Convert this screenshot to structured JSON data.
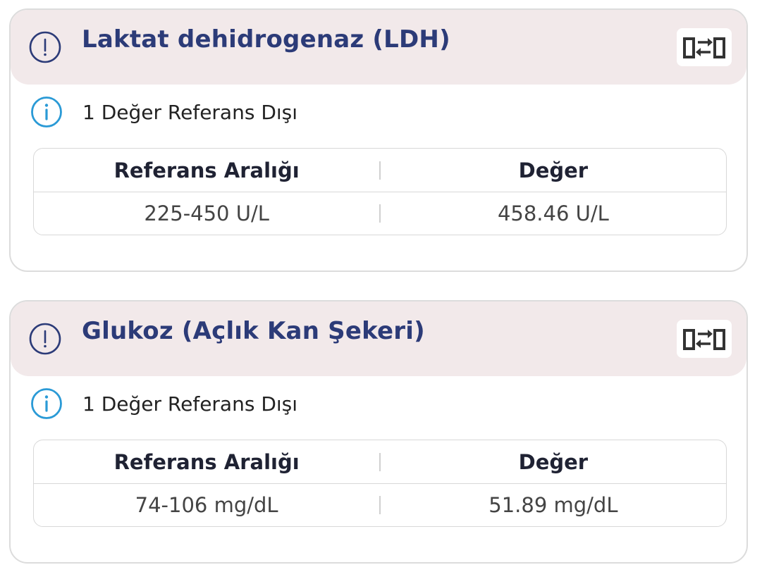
{
  "cards": [
    {
      "title": "Laktat dehidrogenaz (LDH)",
      "warning_icon": "exclamation-circle-icon",
      "compare_icon": "compare-swap-icon",
      "info_icon": "info-circle-icon",
      "info_text": "1 Değer Referans Dışı",
      "table": {
        "headers": [
          "Referans Aralığı",
          "Değer"
        ],
        "row": [
          "225-450 U/L",
          "458.46 U/L"
        ]
      }
    },
    {
      "title": "Glukoz (Açlık Kan Şekeri)",
      "warning_icon": "exclamation-circle-icon",
      "compare_icon": "compare-swap-icon",
      "info_icon": "info-circle-icon",
      "info_text": "1 Değer Referans Dışı",
      "table": {
        "headers": [
          "Referans Aralığı",
          "Değer"
        ],
        "row": [
          "74-106 mg/dL",
          "51.89 mg/dL"
        ]
      }
    }
  ],
  "colors": {
    "title": "#2c3b78",
    "header_bg": "#f2e9ea",
    "info_blue": "#2a9ad6",
    "card_border": "#dcdcdc"
  }
}
